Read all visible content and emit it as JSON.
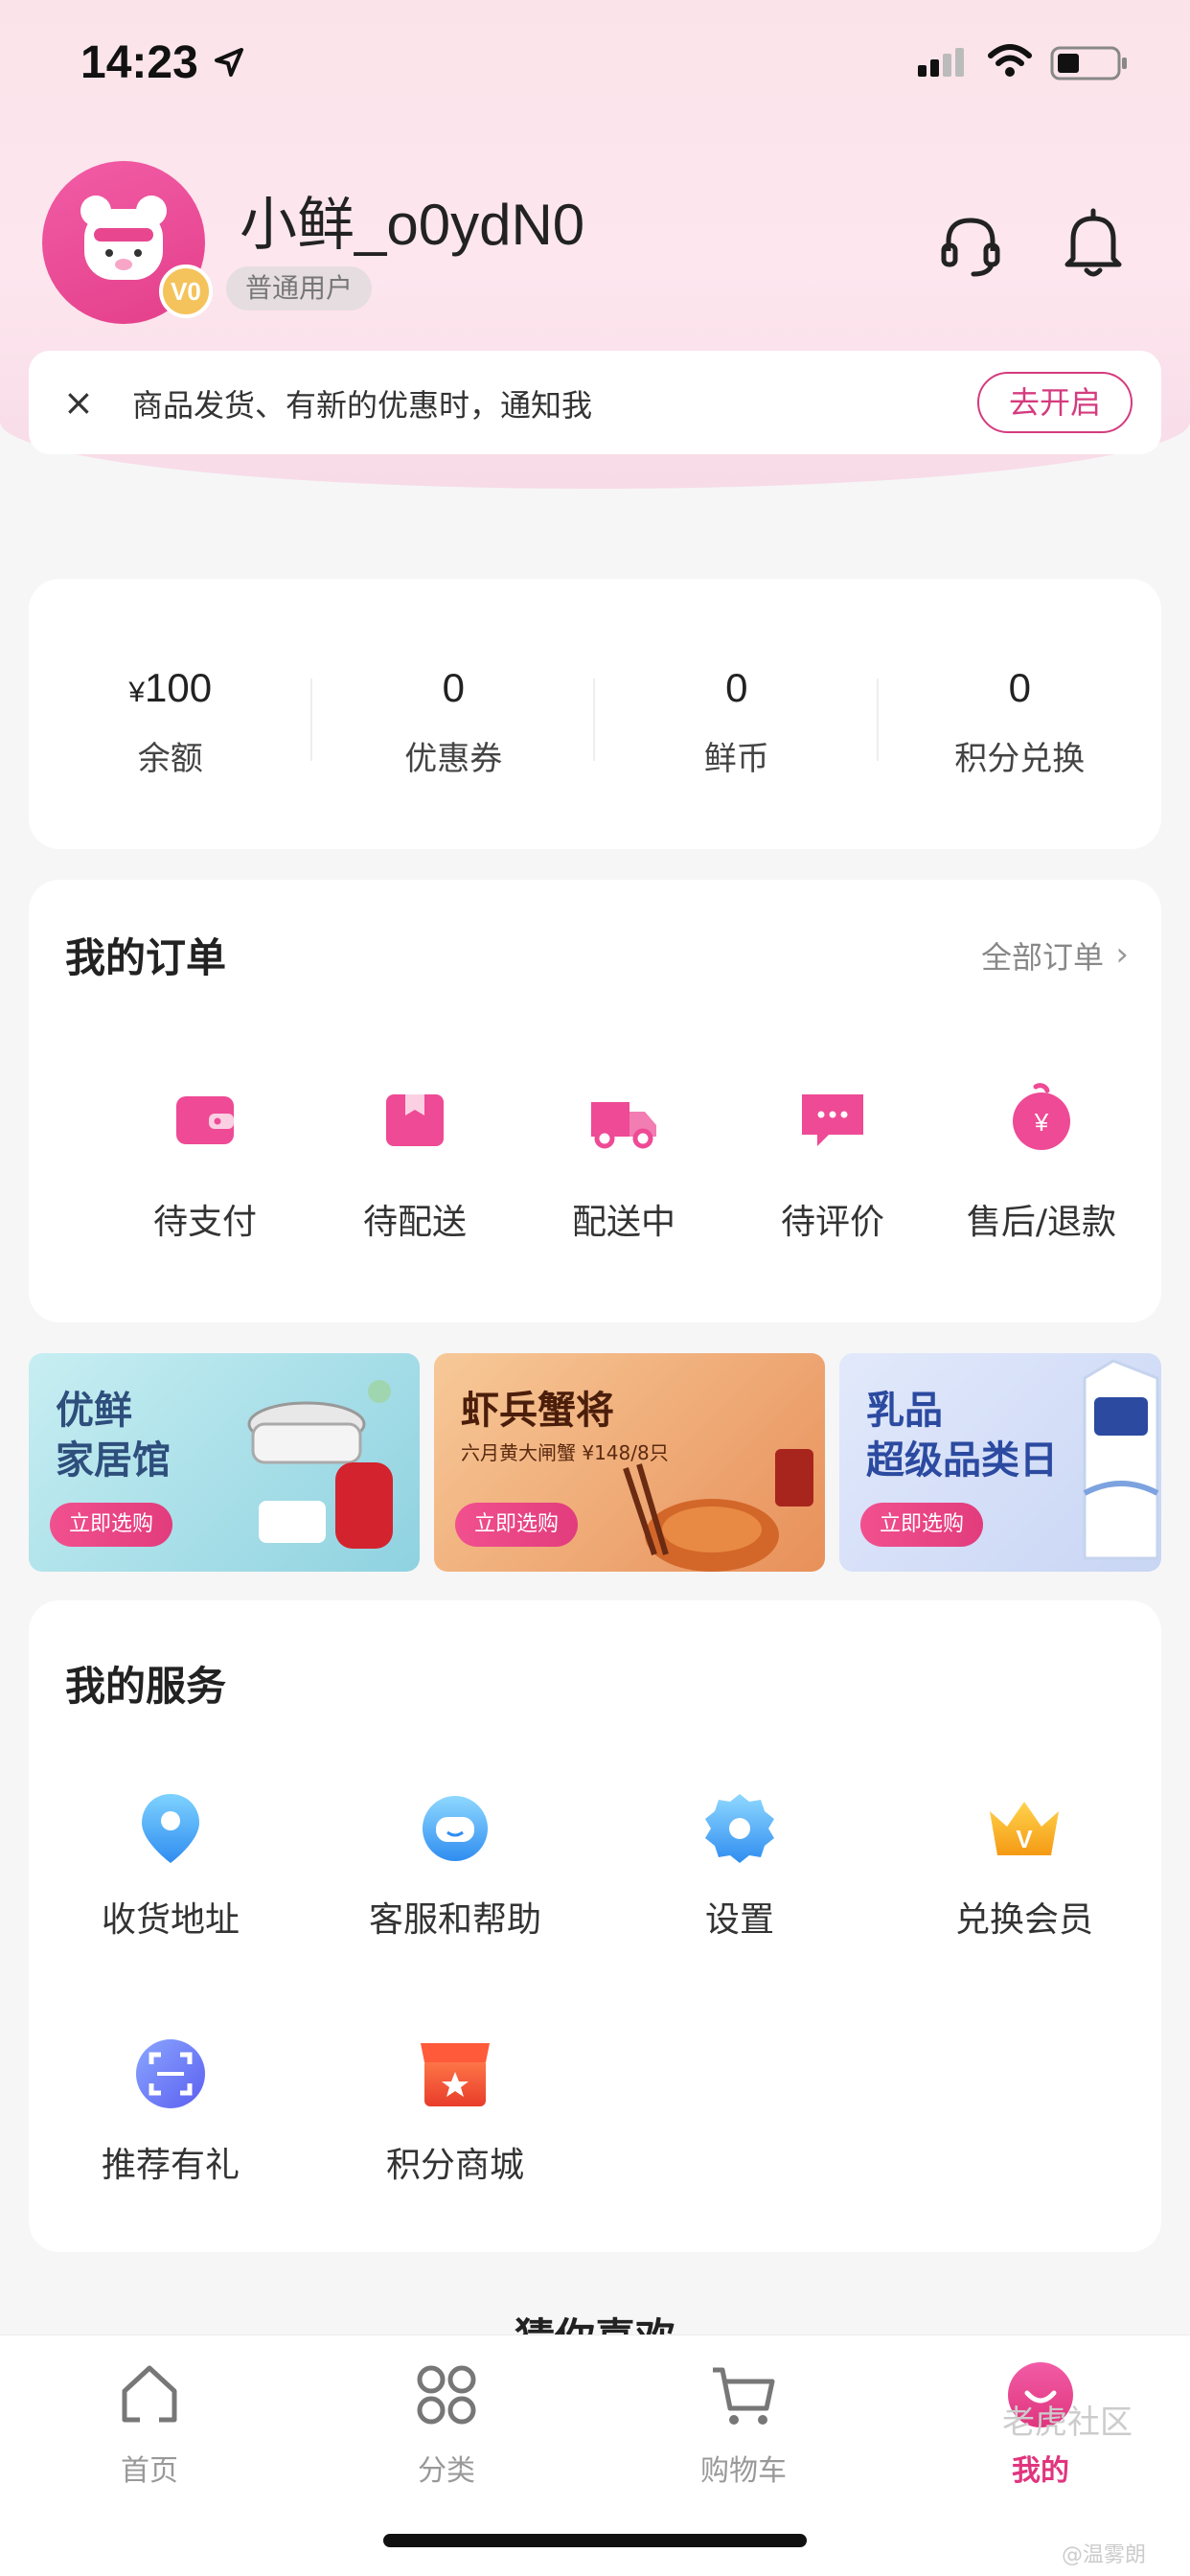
{
  "status_bar": {
    "time": "14:23",
    "icons": [
      "location-arrow-icon",
      "signal-icon",
      "wifi-icon",
      "battery-icon"
    ]
  },
  "profile": {
    "username": "小鲜_o0ydN0",
    "level": "普通用户",
    "vip_badge": "V0",
    "actions": [
      "headset-icon",
      "bell-icon"
    ]
  },
  "notice": {
    "text": "商品发货、有新的优惠时，通知我",
    "button": "去开启",
    "close_icon": "×"
  },
  "assets": [
    {
      "currency": "¥",
      "value": "100",
      "label": "余额"
    },
    {
      "currency": "",
      "value": "0",
      "label": "优惠券"
    },
    {
      "currency": "",
      "value": "0",
      "label": "鲜币"
    },
    {
      "currency": "",
      "value": "0",
      "label": "积分兑换"
    }
  ],
  "orders": {
    "title": "我的订单",
    "all_label": "全部订单",
    "items": [
      {
        "label": "待支付",
        "icon": "wallet-icon"
      },
      {
        "label": "待配送",
        "icon": "package-icon"
      },
      {
        "label": "配送中",
        "icon": "truck-icon"
      },
      {
        "label": "待评价",
        "icon": "comment-icon"
      },
      {
        "label": "售后/退款",
        "icon": "refund-icon"
      }
    ]
  },
  "banners": [
    {
      "title_line1": "优鲜",
      "title_line2": "家居馆",
      "subtitle": "",
      "button": "立即选购",
      "bg": "#bfe7ef",
      "title_color": "#2e4e7c"
    },
    {
      "title_line1": "虾兵蟹将",
      "title_line2": "",
      "subtitle": "六月黄大闸蟹 ¥148/8只",
      "button": "立即选购",
      "bg": "#f0b079",
      "title_color": "#4b1e0b"
    },
    {
      "title_line1": "乳品",
      "title_line2": "超级品类日",
      "subtitle": "",
      "button": "立即选购",
      "bg": "#dbe4f8",
      "title_color": "#2b4aa0"
    }
  ],
  "services": {
    "title": "我的服务",
    "items": [
      {
        "label": "收货地址",
        "icon": "location-pin-icon"
      },
      {
        "label": "客服和帮助",
        "icon": "customer-service-icon"
      },
      {
        "label": "设置",
        "icon": "settings-gear-icon"
      },
      {
        "label": "兑换会员",
        "icon": "crown-icon"
      },
      {
        "label": "推荐有礼",
        "icon": "scan-gift-icon"
      },
      {
        "label": "积分商城",
        "icon": "store-icon"
      }
    ]
  },
  "guess_title": "猜你喜欢",
  "tabbar": [
    {
      "label": "首页",
      "icon": "home-icon",
      "active": false
    },
    {
      "label": "分类",
      "icon": "category-grid-icon",
      "active": false
    },
    {
      "label": "购物车",
      "icon": "cart-icon",
      "active": false
    },
    {
      "label": "我的",
      "icon": "profile-smile-icon",
      "active": true
    }
  ],
  "watermark": {
    "text": "老虎社区",
    "sub": "@温雾朗"
  },
  "colors": {
    "accent": "#e0357e",
    "header_pink": "#fbe3ea"
  }
}
